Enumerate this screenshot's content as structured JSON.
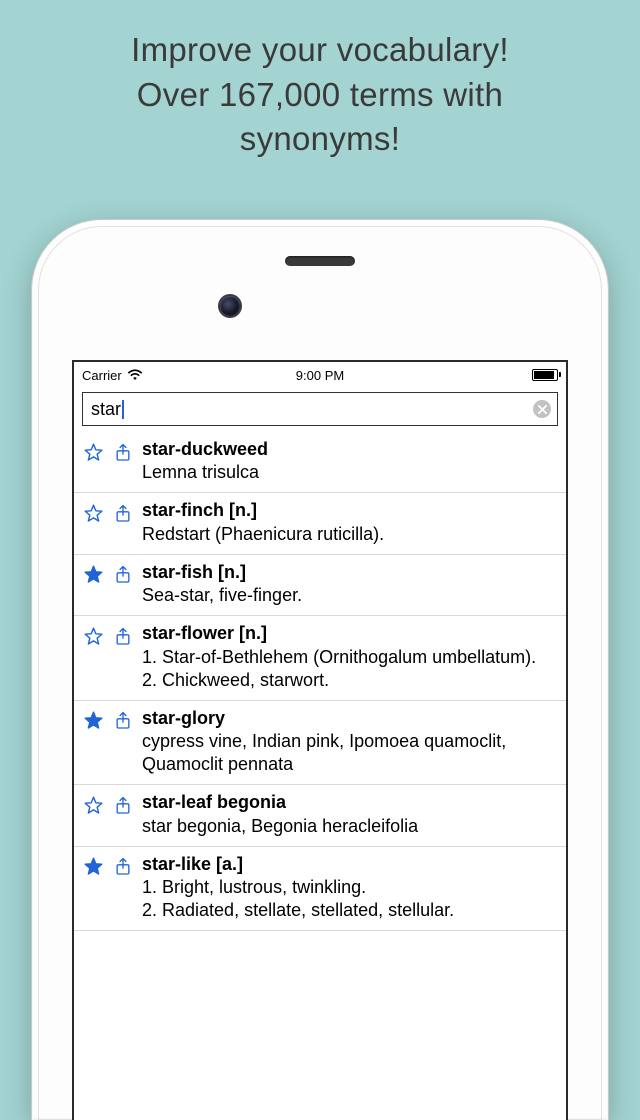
{
  "promo": {
    "line1": "Improve your vocabulary!",
    "line2": "Over 167,000 terms with",
    "line3": "synonyms!"
  },
  "status": {
    "carrier": "Carrier",
    "time": "9:00 PM"
  },
  "search": {
    "value": "star"
  },
  "results": [
    {
      "starred": false,
      "title": "star-duckweed",
      "definition": "Lemna trisulca"
    },
    {
      "starred": false,
      "title": "star-finch [n.]",
      "definition": "Redstart (Phaenicura ruticilla)."
    },
    {
      "starred": true,
      "title": "star-fish [n.]",
      "definition": "Sea-star, five-finger."
    },
    {
      "starred": false,
      "title": "star-flower [n.]",
      "definition": "1. Star-of-Bethlehem (Ornithogalum umbellatum).\n2. Chickweed, starwort."
    },
    {
      "starred": true,
      "title": "star-glory",
      "definition": "cypress vine, Indian pink, Ipomoea quamoclit, Quamoclit pennata"
    },
    {
      "starred": false,
      "title": "star-leaf begonia",
      "definition": "star begonia, Begonia heracleifolia"
    },
    {
      "starred": true,
      "title": "star-like [a.]",
      "definition": "1. Bright, lustrous, twinkling.\n2. Radiated, stellate, stellated, stellular."
    }
  ]
}
